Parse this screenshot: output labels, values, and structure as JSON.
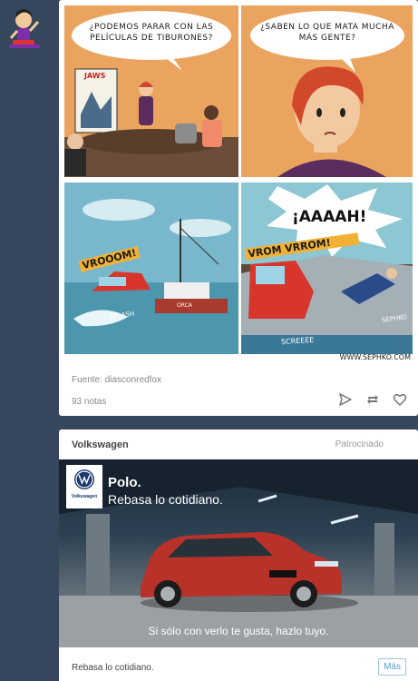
{
  "post1": {
    "comic": {
      "panel1_text": "¿PODEMOS PARAR CON LAS PELÍCULAS DE TIBURONES?",
      "poster_text": "JAWS",
      "panel2_text": "¿SABEN LO QUE MATA MUCHA MÁS GENTE?",
      "panel3_sfx": "VROOOM!",
      "panel3_splash": "SPLASH",
      "boat_name": "ORCA",
      "panel4_scream": "¡AAAAH!",
      "panel4_sfx": "VROM VRROM!",
      "panel4_screech": "SCREEEE",
      "artist_tag": "SEPHKO",
      "signature": "WWW.SEPHKO.COM"
    },
    "source": "Fuente: diasconredfox",
    "notes": "93 notas"
  },
  "post2": {
    "brand": "Volkswagen",
    "sponsored": "Patrocinado",
    "ad": {
      "logo_label": "Volkswagen",
      "title": "Polo.",
      "subtitle": "Rebasa lo cotidiano.",
      "tagline": "Si sólo con verlo te gusta, hazlo tuyo."
    },
    "footer_text": "Rebasa lo cotidiano.",
    "more_button": "Más"
  },
  "colors": {
    "dashboard_bg": "#36465d",
    "comic_orange": "#eaa45f",
    "link_blue": "#529ecc"
  }
}
